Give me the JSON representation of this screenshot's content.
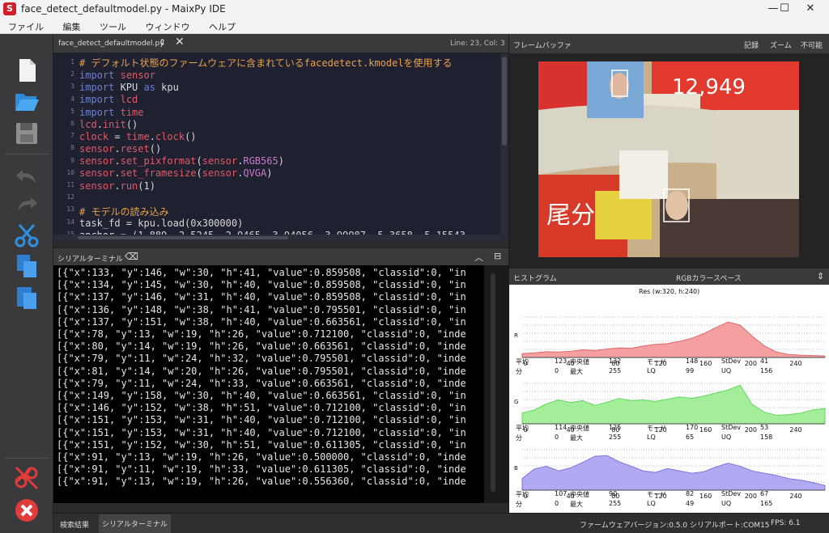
{
  "window": {
    "title": "face_detect_defaultmodel.py - MaixPy IDE",
    "icon": "S",
    "controls": [
      "—",
      "☐",
      "✕"
    ]
  },
  "menu": [
    "ファイル",
    "編集",
    "ツール",
    "ウィンドウ",
    "ヘルプ"
  ],
  "editor": {
    "tab_name": "face_detect_defaultmodel.py",
    "cursor": "Line: 23, Col: 3",
    "line_numbers": [
      "1",
      "2",
      "3",
      "4",
      "5",
      "6",
      "7",
      "8",
      "9",
      "10",
      "11",
      "12",
      "13",
      "14",
      "15"
    ]
  },
  "serial": {
    "title": "シリアルターミナル",
    "lines": [
      "[{\"x\":133, \"y\":146, \"w\":30, \"h\":41, \"value\":0.859508, \"classid\":0, \"in",
      "[{\"x\":134, \"y\":145, \"w\":30, \"h\":40, \"value\":0.859508, \"classid\":0, \"in",
      "[{\"x\":137, \"y\":146, \"w\":31, \"h\":40, \"value\":0.859508, \"classid\":0, \"in",
      "[{\"x\":136, \"y\":148, \"w\":38, \"h\":41, \"value\":0.795501, \"classid\":0, \"in",
      "[{\"x\":137, \"y\":151, \"w\":38, \"h\":40, \"value\":0.663561, \"classid\":0, \"in",
      "[{\"x\":78, \"y\":13, \"w\":19, \"h\":26, \"value\":0.712100, \"classid\":0, \"inde",
      "[{\"x\":80, \"y\":14, \"w\":19, \"h\":26, \"value\":0.663561, \"classid\":0, \"inde",
      "[{\"x\":79, \"y\":11, \"w\":24, \"h\":32, \"value\":0.795501, \"classid\":0, \"inde",
      "[{\"x\":81, \"y\":14, \"w\":20, \"h\":26, \"value\":0.795501, \"classid\":0, \"inde",
      "[{\"x\":79, \"y\":11, \"w\":24, \"h\":33, \"value\":0.663561, \"classid\":0, \"inde",
      "[{\"x\":149, \"y\":158, \"w\":30, \"h\":40, \"value\":0.663561, \"classid\":0, \"in",
      "[{\"x\":146, \"y\":152, \"w\":38, \"h\":51, \"value\":0.712100, \"classid\":0, \"in",
      "[{\"x\":151, \"y\":153, \"w\":31, \"h\":40, \"value\":0.712100, \"classid\":0, \"in",
      "[{\"x\":151, \"y\":153, \"w\":31, \"h\":40, \"value\":0.712100, \"classid\":0, \"in",
      "[{\"x\":151, \"y\":152, \"w\":30, \"h\":51, \"value\":0.611305, \"classid\":0, \"in",
      "[{\"x\":91, \"y\":13, \"w\":19, \"h\":26, \"value\":0.500000, \"classid\":0, \"inde",
      "[{\"x\":91, \"y\":11, \"w\":19, \"h\":33, \"value\":0.611305, \"classid\":0, \"inde",
      "[{\"x\":91, \"y\":13, \"w\":19, \"h\":26, \"value\":0.556360, \"classid\":0, \"inde"
    ]
  },
  "framebuffer": {
    "title": "フレームバッファ",
    "record": "記録",
    "zoom": "ズーム",
    "disable": "不可能"
  },
  "histogram": {
    "title": "ヒストグラム",
    "colorspace": "RGBカラースペース",
    "res": "Res (w:320, h:240)",
    "ticks": [
      "0",
      "40",
      "80",
      "120",
      "160",
      "200",
      "240"
    ],
    "labels": {
      "mean": "平均",
      "median": "中央値",
      "mode": "モード",
      "stdev": "StDev",
      "min": "分",
      "max": "最大",
      "lq": "LQ",
      "uq": "UQ"
    },
    "channel_letters": [
      "R",
      "G",
      "B"
    ],
    "stats": [
      {
        "mean": "123",
        "median": "132",
        "mode": "148",
        "stdev": "41",
        "min": "0",
        "max": "255",
        "lq": "99",
        "uq": "156"
      },
      {
        "mean": "114",
        "median": "125",
        "mode": "170",
        "stdev": "53",
        "min": "0",
        "max": "255",
        "lq": "65",
        "uq": "158"
      },
      {
        "mean": "107",
        "median": "90",
        "mode": "82",
        "stdev": "67",
        "min": "0",
        "max": "255",
        "lq": "49",
        "uq": "165"
      }
    ],
    "colors": [
      "#f4a0a0",
      "#a4ee9a",
      "#b1aaf3"
    ],
    "line_colors": [
      "#e06868",
      "#5ed85a",
      "#7d74e0"
    ]
  },
  "bottom": {
    "search": "検索結果",
    "serial_tab": "シリアルターミナル",
    "firmware": "ファームウェアバージョン:0.5.0",
    "port": "シリアルポート:COM15",
    "fps": "FPS:  6.1"
  }
}
